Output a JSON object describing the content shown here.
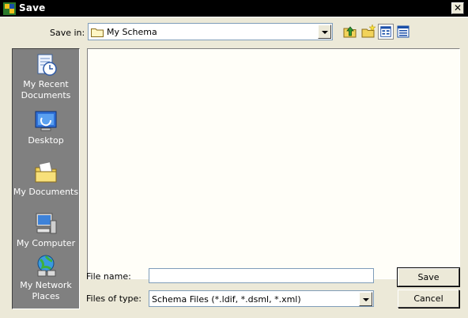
{
  "window": {
    "title": "Save",
    "close_glyph": "✕"
  },
  "toolbar": {
    "save_in_label": "Save in:",
    "save_in_value": "My Schema",
    "buttons": [
      "up-one-level-icon",
      "new-folder-icon",
      "view-list-icon",
      "view-details-icon"
    ]
  },
  "places": [
    {
      "label1": "My Recent",
      "label2": "Documents",
      "icon": "recent-documents-icon"
    },
    {
      "label1": "Desktop",
      "label2": "",
      "icon": "desktop-icon"
    },
    {
      "label1": "My Documents",
      "label2": "",
      "icon": "my-documents-icon"
    },
    {
      "label1": "My Computer",
      "label2": "",
      "icon": "my-computer-icon"
    },
    {
      "label1": "My Network",
      "label2": "Places",
      "icon": "network-places-icon"
    }
  ],
  "form": {
    "file_name_label": "File name:",
    "file_name_value": "",
    "file_type_label": "Files of type:",
    "file_type_value": "Schema Files (*.ldif, *.dsml, *.xml)"
  },
  "buttons": {
    "save": "Save",
    "cancel": "Cancel"
  }
}
